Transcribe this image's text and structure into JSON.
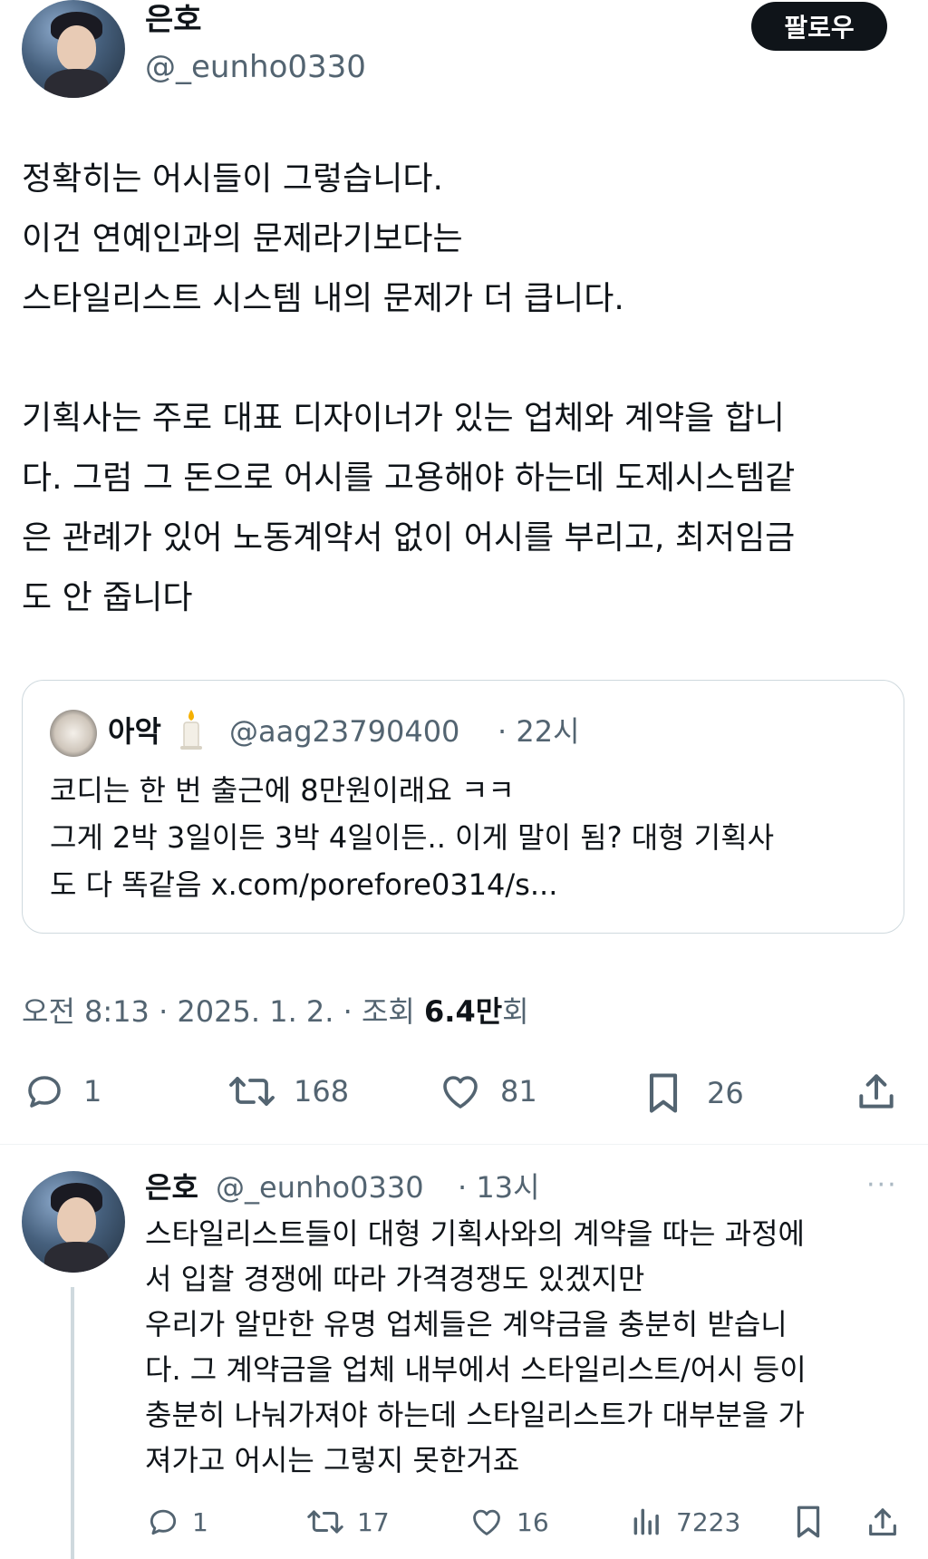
{
  "post": {
    "author_name": "은호",
    "author_handle": "@_eunho0330",
    "follow_label": "팔로우",
    "text_lines": [
      "정확히는 어시들이 그렇습니다.",
      "이건 연예인과의 문제라기보다는",
      "스타일리스트 시스템 내의 문제가 더 큽니다.",
      "",
      "기획사는 주로 대표 디자이너가 있는 업체와 계약을 합니",
      "다. 그럼 그 돈으로 어시를 고용해야 하는데 도제시스템같",
      "은 관례가 있어 노동계약서 없이 어시를 부리고, 최저임금",
      "도 안 줍니다"
    ],
    "meta_time": "오전 8:13 · 2025. 1. 2. · 조회 ",
    "meta_views": "6.4만",
    "meta_views_suffix": "회",
    "actions": {
      "replies": "1",
      "reposts": "168",
      "likes": "81",
      "bookmarks": "26"
    }
  },
  "quote": {
    "author_name": "아악",
    "author_handle": "@aag23790400",
    "time": "· 22시",
    "text_lines": [
      "코디는 한 번 출근에 8만원이래요 ㅋㅋ",
      "그게 2박 3일이든 3박 4일이든.. 이게 말이 됨? 대형 기획사",
      "도 다 똑같음 x.com/porefore0314/s..."
    ]
  },
  "reply": {
    "author_name": "은호",
    "author_handle": "@_eunho0330",
    "time": "· 13시",
    "more_label": "···",
    "text_lines": [
      "스타일리스트들이 대형 기획사와의 계약을 따는 과정에",
      "서 입찰 경쟁에 따라 가격경쟁도 있겠지만",
      "우리가 알만한 유명 업체들은 계약금을 충분히 받습니",
      "다. 그 계약금을 업체 내부에서 스타일리스트/어시 등이",
      "충분히 나눠가져야 하는데 스타일리스트가 대부분을 가",
      "져가고 어시는 그렇지 못한거죠"
    ],
    "actions": {
      "replies": "1",
      "reposts": "17",
      "likes": "16",
      "views": "7223"
    }
  },
  "icons": [
    "reply-icon",
    "repost-icon",
    "like-icon",
    "bookmark-icon",
    "share-icon",
    "views-icon",
    "candle-icon",
    "more-icon"
  ],
  "colors": {
    "text": "#0f1419",
    "muted": "#536471",
    "border": "#cfd9de",
    "button": "#0f1419"
  }
}
